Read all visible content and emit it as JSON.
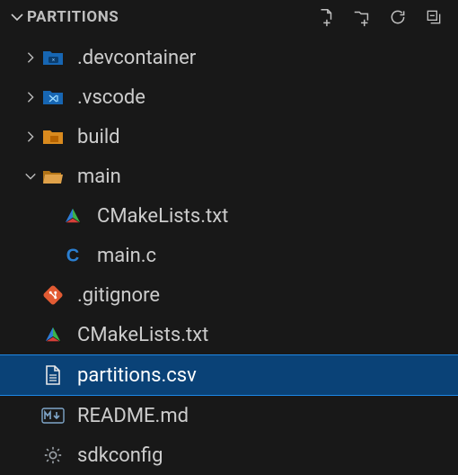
{
  "header": {
    "title": "PARTITIONS"
  },
  "tree": {
    "devcontainer": {
      "label": ".devcontainer"
    },
    "vscode": {
      "label": ".vscode"
    },
    "build": {
      "label": "build"
    },
    "main": {
      "label": "main"
    },
    "main_children": {
      "cmakelists": {
        "label": "CMakeLists.txt"
      },
      "mainc": {
        "label": "main.c"
      }
    },
    "gitignore": {
      "label": ".gitignore"
    },
    "cmakelists_root": {
      "label": "CMakeLists.txt"
    },
    "partitions": {
      "label": "partitions.csv"
    },
    "readme": {
      "label": "README.md"
    },
    "sdkconfig": {
      "label": "sdkconfig"
    }
  },
  "selected": "partitions"
}
